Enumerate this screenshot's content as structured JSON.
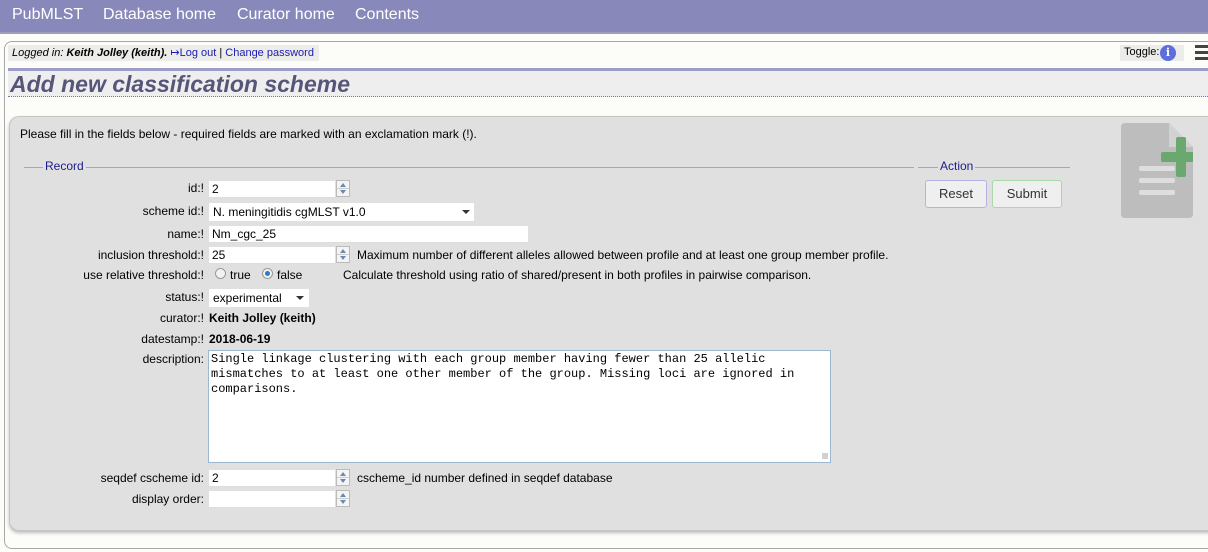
{
  "nav": {
    "items": [
      "PubMLST",
      "Database home",
      "Curator home",
      "Contents"
    ]
  },
  "login": {
    "prefix": "Logged in: ",
    "user": "Keith Jolley (keith).",
    "logout": "Log out",
    "separator": " | ",
    "change_password": "Change password"
  },
  "toggle": {
    "label": "Toggle:",
    "info_glyph": "i"
  },
  "page_title": "Add new classification scheme",
  "intro": "Please fill in the fields below - required fields are marked with an exclamation mark (!).",
  "record_legend": "Record",
  "action_legend": "Action",
  "fields": {
    "id": {
      "label": "id:!",
      "value": "2"
    },
    "scheme_id": {
      "label": "scheme id:!",
      "value": "N. meningitidis cgMLST v1.0"
    },
    "name": {
      "label": "name:!",
      "value": "Nm_cgc_25"
    },
    "inclusion_threshold": {
      "label": "inclusion threshold:!",
      "value": "25",
      "help": "Maximum number of different alleles allowed between profile and at least one group member profile."
    },
    "use_relative_threshold": {
      "label": "use relative threshold:!",
      "options": [
        "true",
        "false"
      ],
      "selected": "false",
      "help": "Calculate threshold using ratio of shared/present in both profiles in pairwise comparison."
    },
    "status": {
      "label": "status:!",
      "value": "experimental"
    },
    "curator": {
      "label": "curator:!",
      "value": "Keith Jolley (keith)"
    },
    "datestamp": {
      "label": "datestamp:!",
      "value": "2018-06-19"
    },
    "description": {
      "label": "description:",
      "value": "Single linkage clustering with each group member having fewer than 25 allelic mismatches to at least one other member of the group. Missing loci are ignored in comparisons."
    },
    "seqdef_cscheme_id": {
      "label": "seqdef cscheme id:",
      "value": "2",
      "help": "cscheme_id number defined in seqdef database"
    },
    "display_order": {
      "label": "display order:",
      "value": ""
    }
  },
  "buttons": {
    "reset": "Reset",
    "submit": "Submit"
  },
  "colors": {
    "nav_bg": "#8888bb",
    "title_color": "#56567a",
    "legend_color": "#1c1c8c",
    "add_icon_green": "#6aa870"
  }
}
